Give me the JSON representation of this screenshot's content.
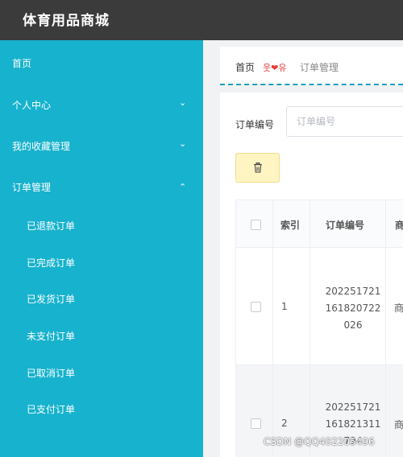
{
  "app": {
    "title": "体育用品商城"
  },
  "sidebar": {
    "items": [
      {
        "label": "首页"
      },
      {
        "label": "个人中心",
        "chevron": "chevron-down-icon"
      },
      {
        "label": "我的收藏管理",
        "chevron": "chevron-down-icon"
      },
      {
        "label": "订单管理",
        "chevron": "chevron-up-icon",
        "expanded": true
      }
    ],
    "sub_items": [
      {
        "label": "已退款订单"
      },
      {
        "label": "已完成订单"
      },
      {
        "label": "已发货订单"
      },
      {
        "label": "未支付订单"
      },
      {
        "label": "已取消订单"
      },
      {
        "label": "已支付订单"
      }
    ]
  },
  "breadcrumb": {
    "home": "首页",
    "separator": "웃❤유",
    "current": "订单管理"
  },
  "search": {
    "label": "订单编号",
    "placeholder": "订单编号",
    "value": ""
  },
  "toolbar": {
    "delete_icon": "trash-icon"
  },
  "table": {
    "columns": [
      "索引",
      "订单编号",
      "商"
    ],
    "rows": [
      {
        "index": "1",
        "order_no_lines": [
          "202251721",
          "161820722",
          "026"
        ],
        "col3": "商"
      },
      {
        "index": "2",
        "order_no_lines": [
          "202251721",
          "161821311",
          "794"
        ],
        "col3": "商"
      }
    ]
  },
  "watermark": "CSDN @QQ402205496",
  "colors": {
    "topbar": "#3b3b3b",
    "sidebar": "#17b2cd",
    "accent": "#1a9dc2",
    "delete_button": "#fff5c3"
  }
}
